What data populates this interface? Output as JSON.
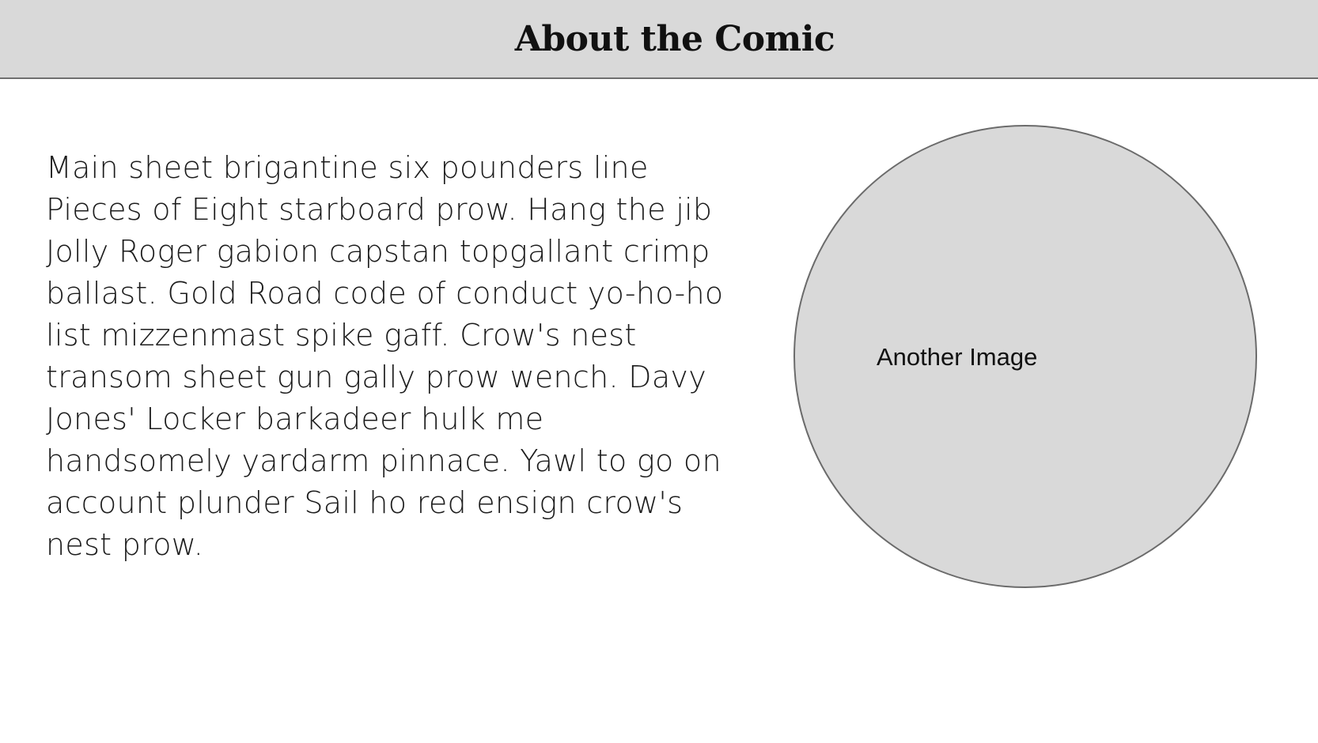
{
  "header": {
    "title": "About the Comic"
  },
  "content": {
    "paragraph": "Main sheet brigantine six pounders line Pieces of Eight starboard prow. Hang the jib Jolly Roger gabion capstan topgallant crimp ballast. Gold Road code of conduct yo-ho-ho list mizzenmast spike gaff. Crow's nest transom sheet gun gally prow wench. Davy Jones' Locker barkadeer hulk me handsomely yardarm pinnace. Yawl to go on account plunder Sail ho red ensign crow's nest prow."
  },
  "image": {
    "label": "Another Image"
  },
  "colors": {
    "header_background": "#d9d9d9",
    "placeholder_fill": "#d9d9d9",
    "border": "#6b6b6b"
  }
}
